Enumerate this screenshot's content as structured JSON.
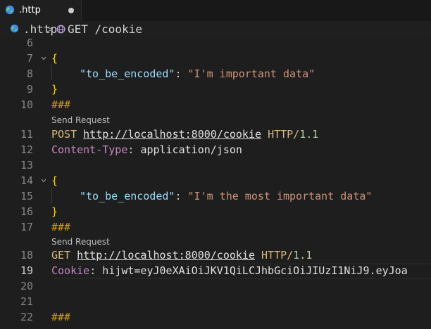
{
  "tab": {
    "label": ".http"
  },
  "breadcrumb": {
    "file": ".http",
    "separator": ">",
    "request": "GET /cookie"
  },
  "lines": [
    {
      "num": "6"
    },
    {
      "num": "7",
      "text": "{"
    },
    {
      "num": "8",
      "key": "\"to_be_encoded\"",
      "colon": ":",
      "value": "\"I'm important data\""
    },
    {
      "num": "9",
      "text": "}"
    },
    {
      "num": "10",
      "text": "###"
    },
    {
      "num": "11",
      "method": "POST",
      "url": "http://localhost:8000/cookie",
      "proto": "HTTP/",
      "ver": "1.1"
    },
    {
      "num": "12",
      "header": "Content-Type",
      "colon": ":",
      "value": "application/json"
    },
    {
      "num": "13"
    },
    {
      "num": "14",
      "text": "{"
    },
    {
      "num": "15",
      "key": "\"to_be_encoded\"",
      "colon": ":",
      "value": "\"I'm the most important data\""
    },
    {
      "num": "16",
      "text": "}"
    },
    {
      "num": "17",
      "text": "###"
    },
    {
      "num": "18",
      "method": "GET",
      "url": "http://localhost:8000/cookie",
      "proto": "HTTP/",
      "ver": "1.1"
    },
    {
      "num": "19",
      "header": "Cookie",
      "colon": ":",
      "value": "hijwt=eyJ0eXAiOiJKV1QiLCJhbGciOiJIUzI1NiJ9.eyJoa"
    },
    {
      "num": "20"
    },
    {
      "num": "21"
    },
    {
      "num": "22",
      "text": "###"
    }
  ],
  "codelens": {
    "send_request_1": "Send Request",
    "send_request_2": "Send Request"
  },
  "colors": {
    "background": "#1e1e1e",
    "brace": "#ffd700",
    "key": "#9cdcfe",
    "string": "#ce9178",
    "separator": "#d4a017",
    "method": "#d7ba7d",
    "header": "#c586c0",
    "version": "#b5cea8"
  },
  "icons": {
    "tab": "globe-icon",
    "breadcrumb_file": "globe-icon",
    "breadcrumb_request": "globe-request-icon",
    "fold": "chevron-down-icon"
  }
}
